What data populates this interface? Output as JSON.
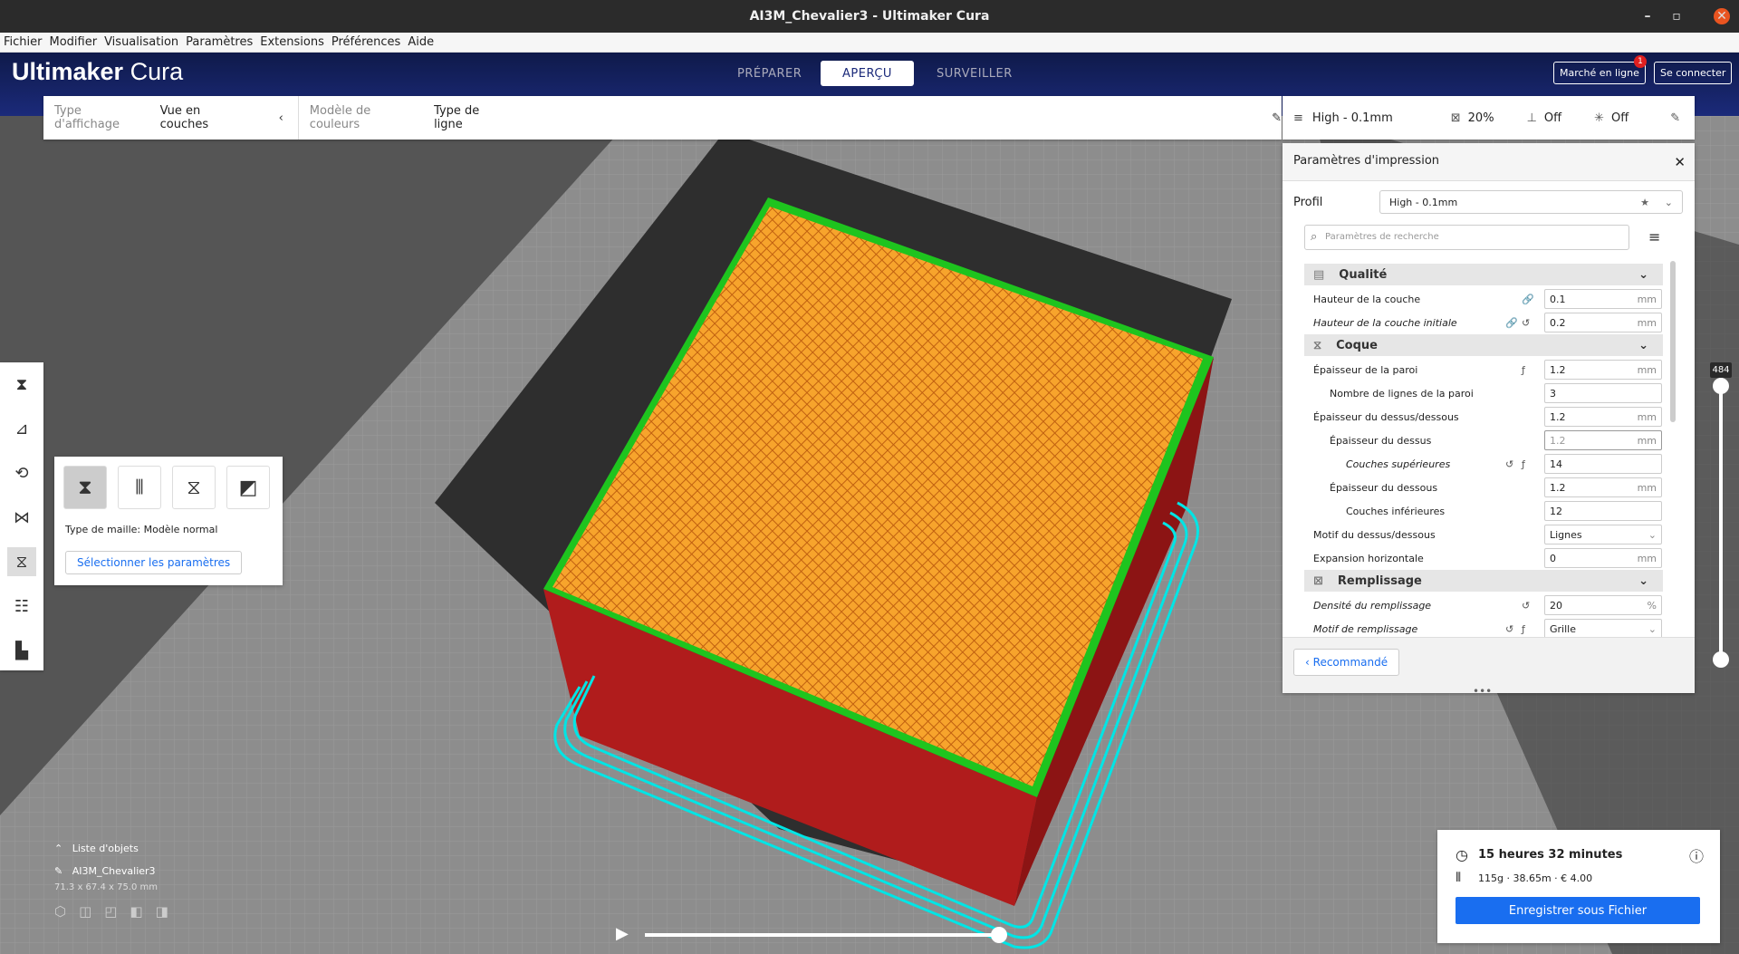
{
  "window": {
    "title": "AI3M_Chevalier3 - Ultimaker Cura"
  },
  "menu": [
    "Fichier",
    "Modifier",
    "Visualisation",
    "Paramètres",
    "Extensions",
    "Préférences",
    "Aide"
  ],
  "header": {
    "logo_bold": "Ultimaker",
    "logo_light": "Cura",
    "stages": [
      "PRÉPARER",
      "APERÇU",
      "SURVEILLER"
    ],
    "marketplace": "Marché en ligne",
    "marketplace_badge": "1",
    "signin": "Se connecter"
  },
  "viewbar": {
    "view_type_label": "Type d'affichage",
    "view_type_value": "Vue en couches",
    "color_scheme_label": "Modèle de couleurs",
    "color_scheme_value": "Type de ligne"
  },
  "printbar": {
    "profile": "High - 0.1mm",
    "infill": "20%",
    "support": "Off",
    "adhesion": "Off"
  },
  "panel": {
    "title": "Paramètres d'impression",
    "profile_label": "Profil",
    "profile_value": "High - 0.1mm",
    "search_placeholder": "Paramètres de recherche",
    "recommended": "Recommandé",
    "categories": {
      "quality": "Qualité",
      "shell": "Coque",
      "infill": "Remplissage"
    },
    "settings": [
      {
        "label": "Hauteur de la couche",
        "value": "0.1",
        "unit": "mm"
      },
      {
        "label": "Hauteur de la couche initiale",
        "value": "0.2",
        "unit": "mm"
      },
      {
        "label": "Épaisseur de la paroi",
        "value": "1.2",
        "unit": "mm"
      },
      {
        "label": "Nombre de lignes de la paroi",
        "value": "3",
        "unit": ""
      },
      {
        "label": "Épaisseur du dessus/dessous",
        "value": "1.2",
        "unit": "mm"
      },
      {
        "label": "Épaisseur du dessus",
        "value": "1.2",
        "unit": "mm"
      },
      {
        "label": "Couches supérieures",
        "value": "14",
        "unit": ""
      },
      {
        "label": "Épaisseur du dessous",
        "value": "1.2",
        "unit": "mm"
      },
      {
        "label": "Couches inférieures",
        "value": "12",
        "unit": ""
      },
      {
        "label": "Motif du dessus/dessous",
        "value": "Lignes",
        "unit": ""
      },
      {
        "label": "Expansion horizontale",
        "value": "0",
        "unit": "mm"
      },
      {
        "label": "Densité du remplissage",
        "value": "20",
        "unit": "%"
      },
      {
        "label": "Motif de remplissage",
        "value": "Grille",
        "unit": ""
      }
    ]
  },
  "layer_slider": {
    "value": "484"
  },
  "mesh_popup": {
    "mesh_type": "Type de maille: Modèle normal",
    "select_button": "Sélectionner les paramètres"
  },
  "object_list": {
    "title": "Liste d'objets",
    "object_name": "AI3M_Chevalier3",
    "dimensions": "71.3 x 67.4 x 75.0 mm"
  },
  "estimate": {
    "time": "15 heures 32 minutes",
    "material": "115g · 38.65m · € 4.00",
    "save_button": "Enregistrer sous Fichier"
  },
  "colors": {
    "header": "#1b2a7a",
    "accent": "#196ef0",
    "badge": "#e02020"
  }
}
